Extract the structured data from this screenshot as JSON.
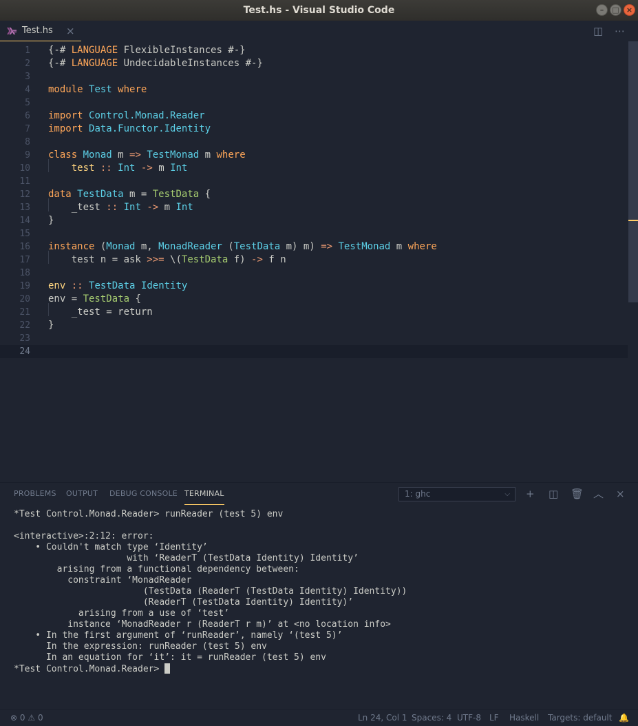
{
  "window": {
    "title": "Test.hs - Visual Studio Code"
  },
  "tab": {
    "title": "Test.hs",
    "close": "×"
  },
  "editor": {
    "lines": [
      [
        {
          "t": "{-# ",
          "c": ""
        },
        {
          "t": "LANGUAGE",
          "c": "kw"
        },
        {
          "t": " FlexibleInstances #-}",
          "c": ""
        }
      ],
      [
        {
          "t": "{-# ",
          "c": ""
        },
        {
          "t": "LANGUAGE",
          "c": "kw"
        },
        {
          "t": " UndecidableInstances #-}",
          "c": ""
        }
      ],
      [],
      [
        {
          "t": "module",
          "c": "kw"
        },
        {
          "t": " ",
          "c": ""
        },
        {
          "t": "Test",
          "c": "ty"
        },
        {
          "t": " ",
          "c": ""
        },
        {
          "t": "where",
          "c": "kw"
        }
      ],
      [],
      [
        {
          "t": "import",
          "c": "kw"
        },
        {
          "t": " ",
          "c": ""
        },
        {
          "t": "Control.Monad.Reader",
          "c": "md"
        }
      ],
      [
        {
          "t": "import",
          "c": "kw"
        },
        {
          "t": " ",
          "c": ""
        },
        {
          "t": "Data.Functor.Identity",
          "c": "md"
        }
      ],
      [],
      [
        {
          "t": "class",
          "c": "kw"
        },
        {
          "t": " ",
          "c": ""
        },
        {
          "t": "Monad",
          "c": "ty"
        },
        {
          "t": " m ",
          "c": ""
        },
        {
          "t": "=>",
          "c": "op"
        },
        {
          "t": " ",
          "c": ""
        },
        {
          "t": "TestMonad",
          "c": "ty"
        },
        {
          "t": " m ",
          "c": ""
        },
        {
          "t": "where",
          "c": "kw"
        }
      ],
      [
        {
          "t": "    ",
          "c": ""
        },
        {
          "t": "test",
          "c": "fn"
        },
        {
          "t": " ",
          "c": ""
        },
        {
          "t": "::",
          "c": "op"
        },
        {
          "t": " ",
          "c": ""
        },
        {
          "t": "Int",
          "c": "ty"
        },
        {
          "t": " ",
          "c": ""
        },
        {
          "t": "->",
          "c": "op"
        },
        {
          "t": " m ",
          "c": ""
        },
        {
          "t": "Int",
          "c": "ty"
        }
      ],
      [],
      [
        {
          "t": "data",
          "c": "kw"
        },
        {
          "t": " ",
          "c": ""
        },
        {
          "t": "TestData",
          "c": "ty"
        },
        {
          "t": " m = ",
          "c": ""
        },
        {
          "t": "TestData",
          "c": "cm"
        },
        {
          "t": " {",
          "c": ""
        }
      ],
      [
        {
          "t": "    _test ",
          "c": ""
        },
        {
          "t": "::",
          "c": "op"
        },
        {
          "t": " ",
          "c": ""
        },
        {
          "t": "Int",
          "c": "ty"
        },
        {
          "t": " ",
          "c": ""
        },
        {
          "t": "->",
          "c": "op"
        },
        {
          "t": " m ",
          "c": ""
        },
        {
          "t": "Int",
          "c": "ty"
        }
      ],
      [
        {
          "t": "}",
          "c": ""
        }
      ],
      [],
      [
        {
          "t": "instance",
          "c": "kw"
        },
        {
          "t": " (",
          "c": ""
        },
        {
          "t": "Monad",
          "c": "ty"
        },
        {
          "t": " m, ",
          "c": ""
        },
        {
          "t": "MonadReader",
          "c": "ty"
        },
        {
          "t": " (",
          "c": ""
        },
        {
          "t": "TestData",
          "c": "ty"
        },
        {
          "t": " m) m) ",
          "c": ""
        },
        {
          "t": "=>",
          "c": "op"
        },
        {
          "t": " ",
          "c": ""
        },
        {
          "t": "TestMonad",
          "c": "ty"
        },
        {
          "t": " m ",
          "c": ""
        },
        {
          "t": "where",
          "c": "kw"
        }
      ],
      [
        {
          "t": "    test n = ask ",
          "c": ""
        },
        {
          "t": ">>=",
          "c": "op"
        },
        {
          "t": " \\(",
          "c": ""
        },
        {
          "t": "TestData",
          "c": "cm"
        },
        {
          "t": " f) ",
          "c": ""
        },
        {
          "t": "->",
          "c": "op"
        },
        {
          "t": " f n",
          "c": ""
        }
      ],
      [],
      [
        {
          "t": "env",
          "c": "fn"
        },
        {
          "t": " ",
          "c": ""
        },
        {
          "t": "::",
          "c": "op"
        },
        {
          "t": " ",
          "c": ""
        },
        {
          "t": "TestData",
          "c": "ty"
        },
        {
          "t": " ",
          "c": ""
        },
        {
          "t": "Identity",
          "c": "ty"
        }
      ],
      [
        {
          "t": "env = ",
          "c": ""
        },
        {
          "t": "TestData",
          "c": "cm"
        },
        {
          "t": " {",
          "c": ""
        }
      ],
      [
        {
          "t": "    _test = return",
          "c": ""
        }
      ],
      [
        {
          "t": "}",
          "c": ""
        }
      ],
      [],
      []
    ],
    "current_line": 24
  },
  "panel": {
    "tabs": [
      "PROBLEMS",
      "OUTPUT",
      "DEBUG CONSOLE",
      "TERMINAL"
    ],
    "active_tab": "TERMINAL",
    "terminal_select": "1: ghc",
    "terminal_lines": [
      "*Test Control.Monad.Reader> runReader (test 5) env",
      "",
      "<interactive>:2:12: error:",
      "    • Couldn't match type ‘Identity’",
      "                     with ‘ReaderT (TestData Identity) Identity’",
      "        arising from a functional dependency between:",
      "          constraint ‘MonadReader",
      "                        (TestData (ReaderT (TestData Identity) Identity))",
      "                        (ReaderT (TestData Identity) Identity)’",
      "            arising from a use of ‘test’",
      "          instance ‘MonadReader r (ReaderT r m)’ at <no location info>",
      "    • In the first argument of ‘runReader’, namely ‘(test 5)’",
      "      In the expression: runReader (test 5) env",
      "      In an equation for ‘it’: it = runReader (test 5) env",
      "*Test Control.Monad.Reader> "
    ]
  },
  "status": {
    "errors": "0",
    "warnings": "0",
    "position": "Ln 24, Col 1",
    "spaces": "Spaces: 4",
    "encoding": "UTF-8",
    "eol": "LF",
    "language": "Haskell",
    "targets": "Targets: default"
  },
  "colors": {
    "accent": "#ffcc66",
    "background": "#1f2430"
  }
}
